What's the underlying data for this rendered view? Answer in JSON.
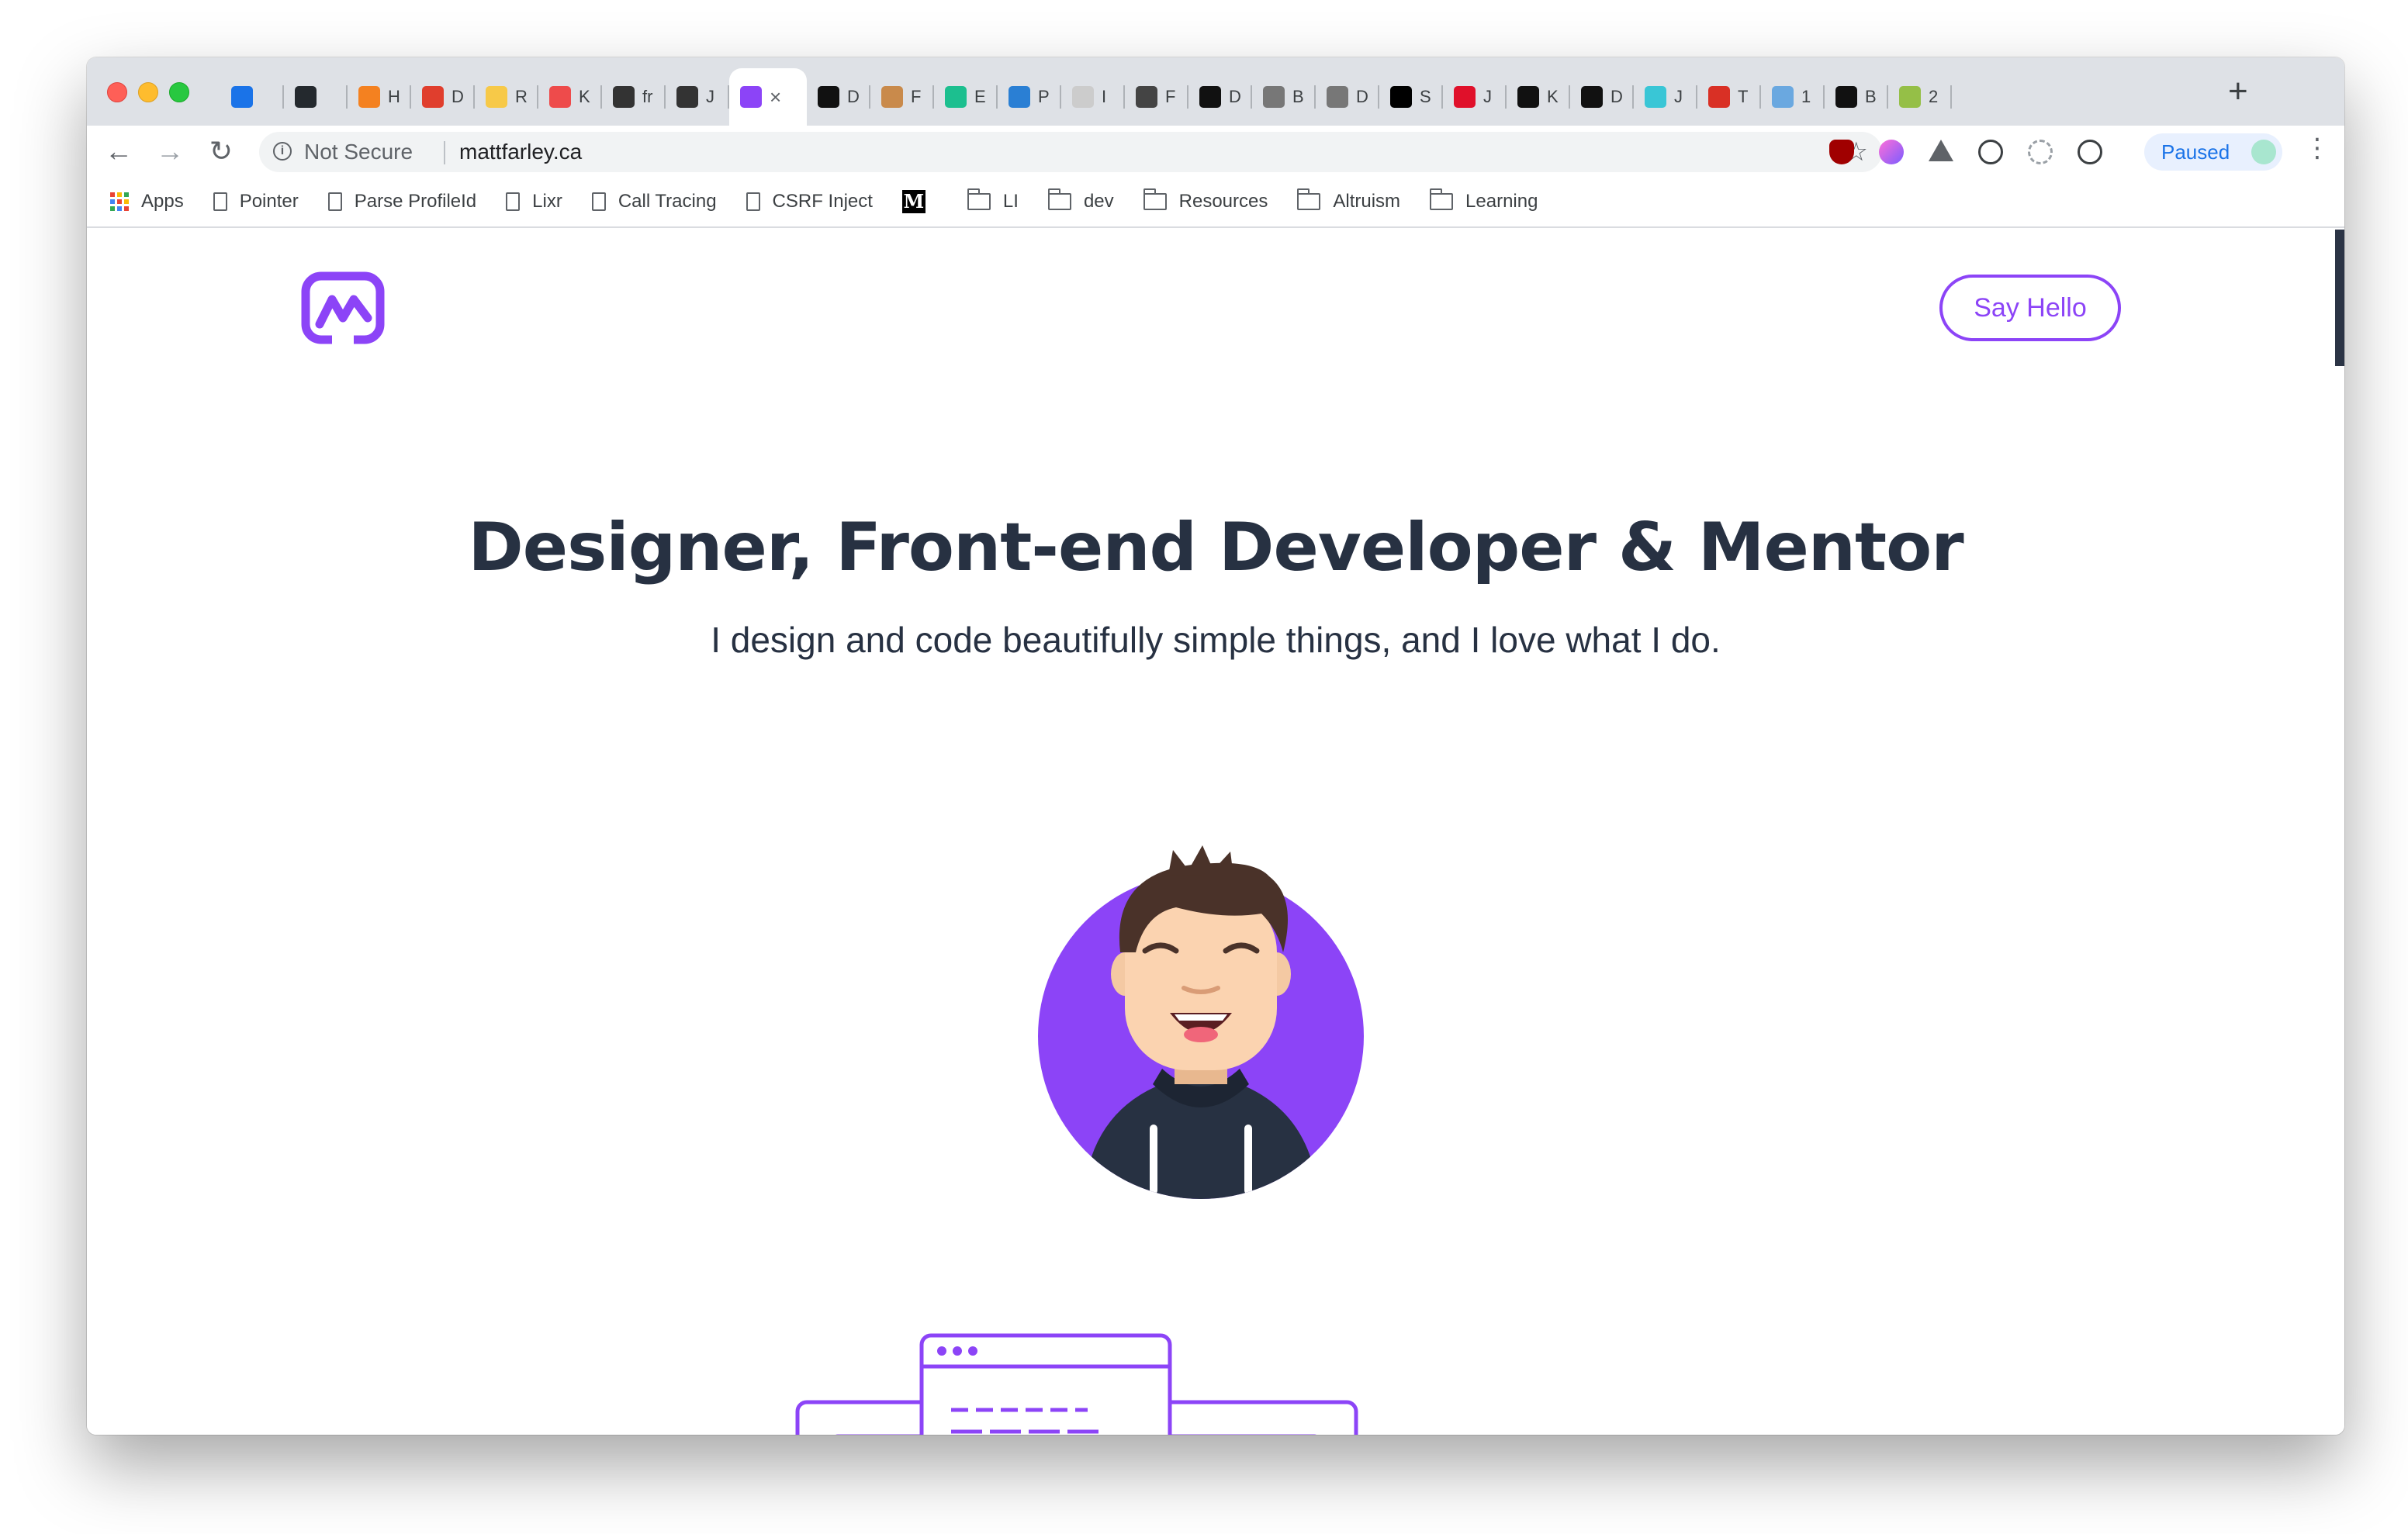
{
  "browser": {
    "tabs": [
      {
        "icon": "inbox-icon",
        "label": "",
        "color": "#1a73e8"
      },
      {
        "icon": "github-icon",
        "label": "",
        "color": "#24292e"
      },
      {
        "icon": "cloudflare-icon",
        "label": "H",
        "color": "#f48120"
      },
      {
        "icon": "qa-icon",
        "label": "D",
        "color": "#e03e2d"
      },
      {
        "icon": "sparkle-icon",
        "label": "R",
        "color": "#f7c948"
      },
      {
        "icon": "red-square-icon",
        "label": "K",
        "color": "#ee4b4b"
      },
      {
        "icon": "font-icon",
        "label": "fr",
        "color": "#333333"
      },
      {
        "icon": "j-icon",
        "label": "J",
        "color": "#333333"
      },
      {
        "icon": "mattfarley-logo-icon",
        "label": "",
        "color": "#8c44f7",
        "active": true
      },
      {
        "icon": "d-icon",
        "label": "D",
        "color": "#111111"
      },
      {
        "icon": "avatar-icon",
        "label": "F",
        "color": "#c98a4b"
      },
      {
        "icon": "green-circle-icon",
        "label": "E",
        "color": "#1cbf8f"
      },
      {
        "icon": "p-circle-icon",
        "label": "P",
        "color": "#2a7fd4"
      },
      {
        "icon": "flag-icon",
        "label": "I",
        "color": "#cccccc"
      },
      {
        "icon": "photo-icon",
        "label": "F",
        "color": "#444444"
      },
      {
        "icon": "dc-icon",
        "label": "D",
        "color": "#111111"
      },
      {
        "icon": "b-icon",
        "label": "B",
        "color": "#777777"
      },
      {
        "icon": "doc-icon",
        "label": "D",
        "color": "#777777"
      },
      {
        "icon": "sk-icon",
        "label": "S",
        "color": "#000000"
      },
      {
        "icon": "red-swirl-icon",
        "label": "J",
        "color": "#e0102a"
      },
      {
        "icon": "triangle-icon",
        "label": "K",
        "color": "#111111"
      },
      {
        "icon": "bolt-icon",
        "label": "D",
        "color": "#111111"
      },
      {
        "icon": "j-color-icon",
        "label": "J",
        "color": "#39c6d6"
      },
      {
        "icon": "m-red-icon",
        "label": "T",
        "color": "#d93025"
      },
      {
        "icon": "eye-icon",
        "label": "1",
        "color": "#6aa8e0"
      },
      {
        "icon": "w-icon",
        "label": "B",
        "color": "#111111"
      },
      {
        "icon": "shopify-icon",
        "label": "2",
        "color": "#95bf47"
      }
    ],
    "active_tab_close": "×",
    "new_tab": "+",
    "address": {
      "security": "Not Secure",
      "url": "mattfarley.ca"
    },
    "profile": {
      "label": "Paused"
    },
    "bookmarks": [
      {
        "type": "apps",
        "label": "Apps"
      },
      {
        "type": "page",
        "label": "Pointer"
      },
      {
        "type": "page",
        "label": "Parse ProfileId"
      },
      {
        "type": "page",
        "label": "Lixr"
      },
      {
        "type": "page",
        "label": "Call Tracing"
      },
      {
        "type": "page",
        "label": "CSRF Inject"
      },
      {
        "type": "medium",
        "label": ""
      },
      {
        "type": "folder",
        "label": "LI"
      },
      {
        "type": "folder",
        "label": "dev"
      },
      {
        "type": "folder",
        "label": "Resources"
      },
      {
        "type": "folder",
        "label": "Altruism"
      },
      {
        "type": "folder",
        "label": "Learning"
      }
    ]
  },
  "site": {
    "cta": "Say Hello",
    "hero": {
      "title": "Designer, Front-end Developer & Mentor",
      "subtitle": "I design and code beautifully simple things, and I love what I do."
    }
  },
  "colors": {
    "brand_purple": "#8c44f7",
    "heading": "#273142"
  }
}
